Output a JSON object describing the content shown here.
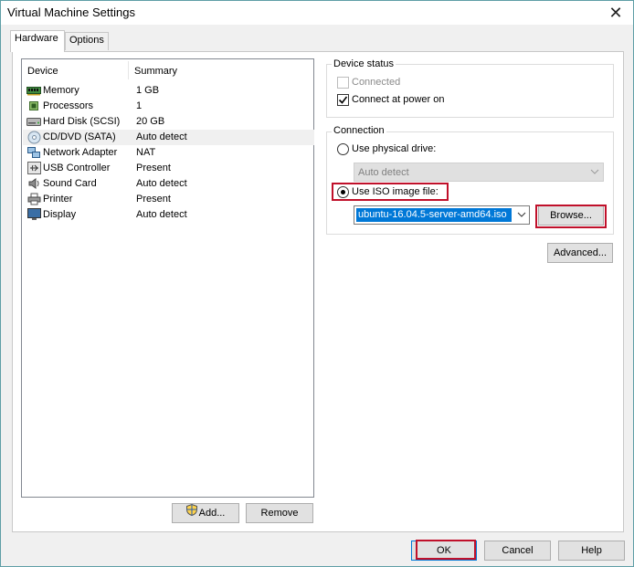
{
  "window": {
    "title": "Virtual Machine Settings",
    "close_glyph": "✕"
  },
  "tabs": [
    {
      "label": "Hardware"
    },
    {
      "label": "Options"
    }
  ],
  "device_list": {
    "columns": {
      "device": "Device",
      "summary": "Summary"
    },
    "rows": [
      {
        "name": "Memory",
        "summary": "1 GB",
        "icon": "memory-icon"
      },
      {
        "name": "Processors",
        "summary": "1",
        "icon": "processor-icon"
      },
      {
        "name": "Hard Disk (SCSI)",
        "summary": "20 GB",
        "icon": "hard-disk-icon"
      },
      {
        "name": "CD/DVD (SATA)",
        "summary": "Auto detect",
        "icon": "cd-dvd-icon",
        "selected": true
      },
      {
        "name": "Network Adapter",
        "summary": "NAT",
        "icon": "network-adapter-icon"
      },
      {
        "name": "USB Controller",
        "summary": "Present",
        "icon": "usb-icon"
      },
      {
        "name": "Sound Card",
        "summary": "Auto detect",
        "icon": "sound-card-icon"
      },
      {
        "name": "Printer",
        "summary": "Present",
        "icon": "printer-icon"
      },
      {
        "name": "Display",
        "summary": "Auto detect",
        "icon": "display-icon"
      }
    ],
    "add_label": "Add...",
    "remove_label": "Remove"
  },
  "device_status": {
    "title": "Device status",
    "connected_label": "Connected",
    "connected_checked": false,
    "connect_power_on_label": "Connect at power on",
    "connect_power_on_checked": true
  },
  "connection": {
    "title": "Connection",
    "physical_drive_label": "Use physical drive:",
    "physical_drive_value": "Auto detect",
    "iso_label": "Use ISO image file:",
    "iso_value": "ubuntu-16.04.5-server-amd64.iso",
    "browse_label": "Browse...",
    "selected_option": "iso"
  },
  "advanced_label": "Advanced...",
  "footer": {
    "ok_label": "OK",
    "cancel_label": "Cancel",
    "help_label": "Help"
  },
  "colors": {
    "highlight": "#c0102a",
    "selection": "#0078d7"
  }
}
